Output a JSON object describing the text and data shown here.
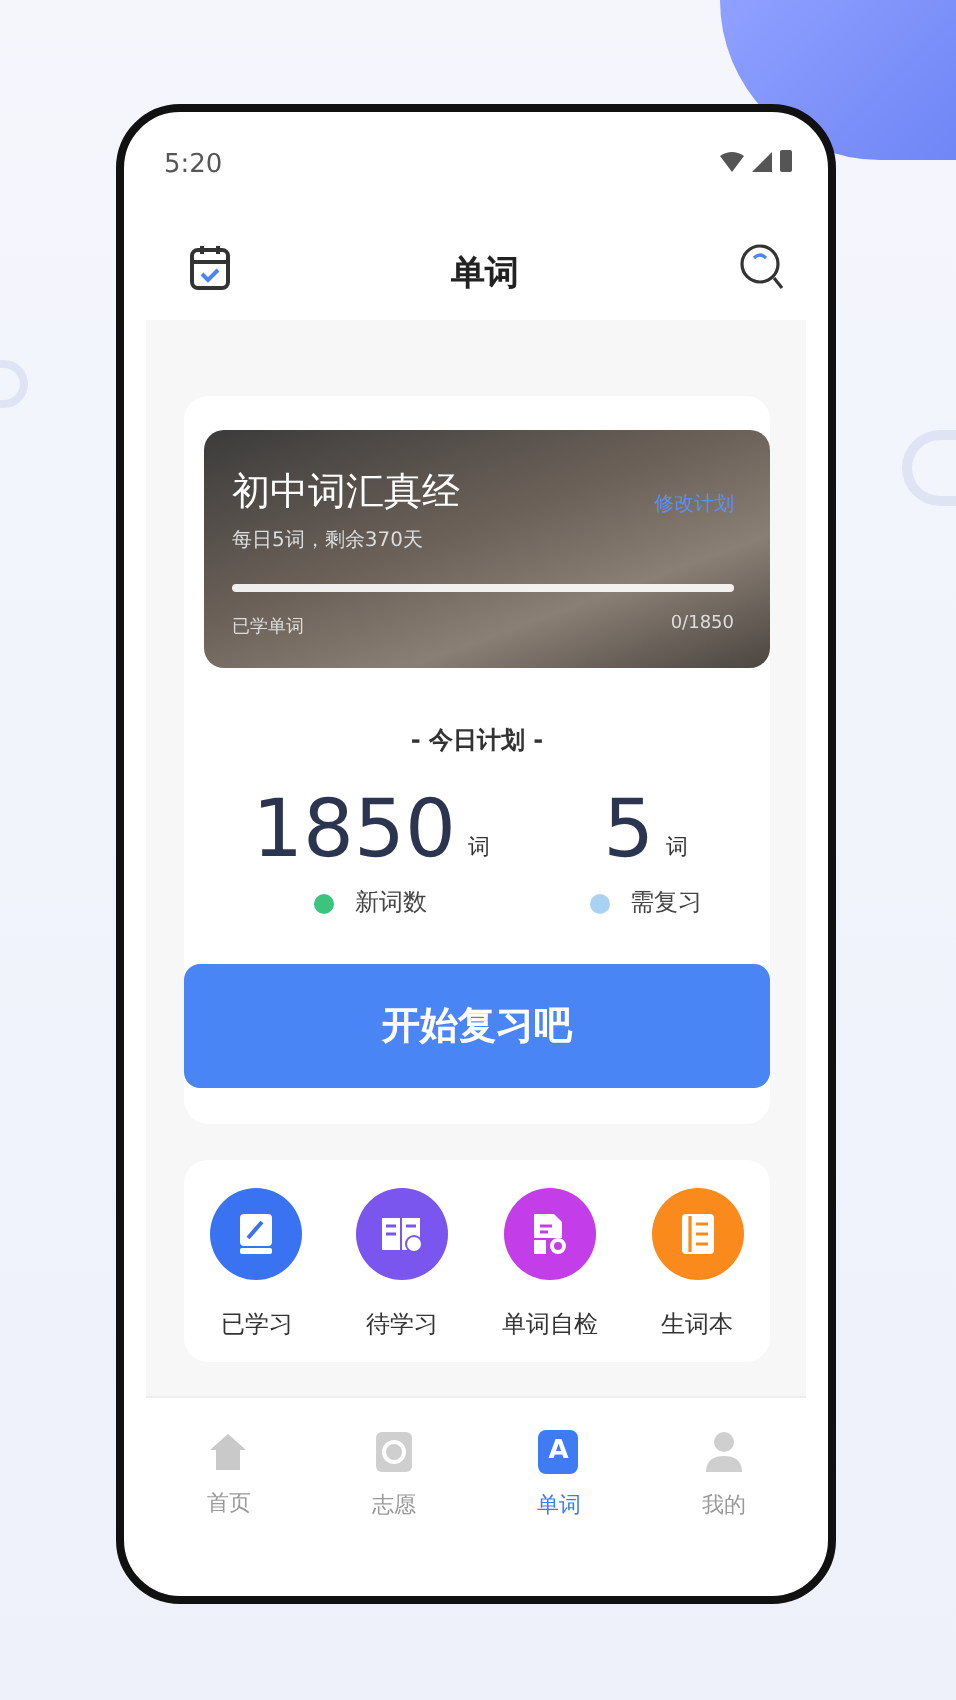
{
  "status_bar": {
    "time": "5:20"
  },
  "header": {
    "title": "单词"
  },
  "plan_banner": {
    "title": "初中词汇真经",
    "edit_link": "修改计划",
    "subtitle": "每日5词，剩余370天",
    "progress": {
      "level": 0
    },
    "progress_label": "已学单词",
    "progress_count": "0/1850"
  },
  "today_plan": {
    "heading": "- 今日计划 -",
    "stats": [
      {
        "value": "1850",
        "unit": "词",
        "label": "新词数",
        "color": "#3cc47c"
      },
      {
        "value": "5",
        "unit": "词",
        "label": "需复习",
        "color": "#a9d3f0"
      }
    ],
    "button": "开始复习吧"
  },
  "features": [
    {
      "kind": "learned",
      "label": "已学习",
      "color": "#3a73f2"
    },
    {
      "kind": "pending",
      "label": "待学习",
      "color": "#7a55ee"
    },
    {
      "kind": "check",
      "label": "单词自检",
      "color": "#c33de8"
    },
    {
      "kind": "notebook",
      "label": "生词本",
      "color": "#fb8a1c"
    }
  ],
  "tabs": [
    {
      "kind": "home",
      "label": "首页",
      "selected": false
    },
    {
      "kind": "wish",
      "label": "志愿",
      "selected": false
    },
    {
      "kind": "words",
      "label": "单词",
      "selected": true,
      "icon_letter": "A"
    },
    {
      "kind": "me",
      "label": "我的",
      "selected": false
    }
  ]
}
